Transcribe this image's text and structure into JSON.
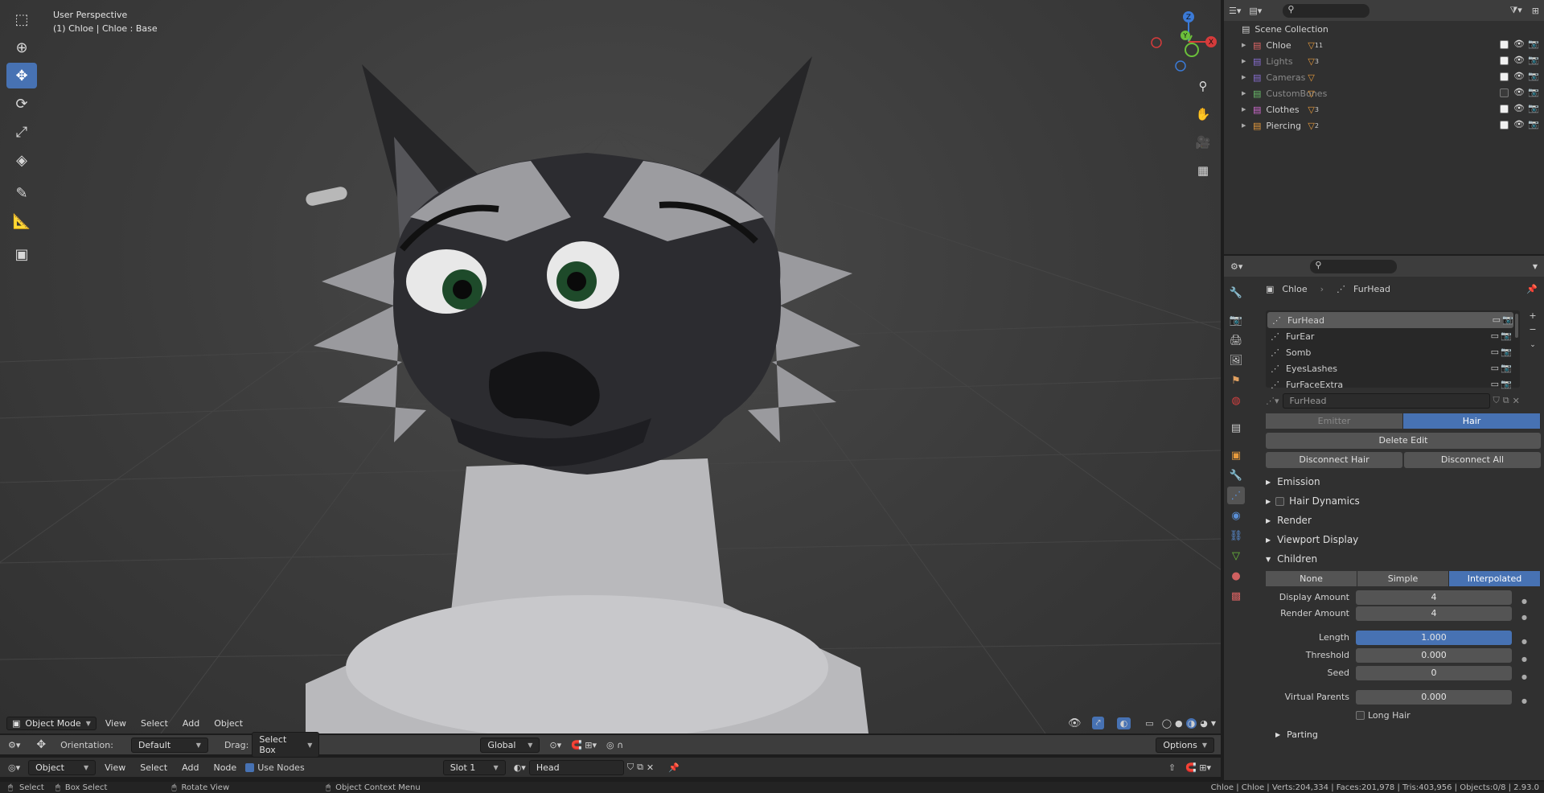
{
  "viewport": {
    "title": "User Perspective",
    "subtitle": "(1) Chloe | Chloe : Base",
    "tools": [
      "select-box-icon",
      "cursor-icon",
      "move-icon",
      "rotate-icon",
      "scale-icon",
      "transform-icon",
      "annotate-icon",
      "measure-icon",
      "add-cube-icon"
    ],
    "gizmo": {
      "z": "Z",
      "y": "Y",
      "x": "X"
    },
    "header": {
      "mode": "Object Mode",
      "menus": [
        "View",
        "Select",
        "Add",
        "Object"
      ]
    }
  },
  "tool_settings": {
    "orientation_label": "Orientation:",
    "orientation_value": "Default",
    "drag_label": "Drag:",
    "drag_value": "Select Box",
    "transform_space": "Global",
    "options": "Options"
  },
  "node_editor": {
    "mode": "Object",
    "menus": [
      "View",
      "Select",
      "Add",
      "Node"
    ],
    "use_nodes": "Use Nodes",
    "slot": "Slot 1",
    "material": "Head"
  },
  "outliner": {
    "root": "Scene Collection",
    "items": [
      {
        "name": "Chloe",
        "badge": "11",
        "color": "#e06666",
        "checked": true,
        "dim": false
      },
      {
        "name": "Lights",
        "badge": "3",
        "color": "#8a6fd6",
        "checked": true,
        "dim": true
      },
      {
        "name": "Cameras",
        "badge": "",
        "color": "#8a6fd6",
        "checked": true,
        "dim": true
      },
      {
        "name": "CustomBones",
        "badge": "",
        "color": "#6bbf6b",
        "checked": false,
        "dim": true
      },
      {
        "name": "Clothes",
        "badge": "3",
        "color": "#d46cd4",
        "checked": true,
        "dim": false
      },
      {
        "name": "Piercing",
        "badge": "2",
        "color": "#e69a3c",
        "checked": true,
        "dim": false
      }
    ]
  },
  "properties": {
    "breadcrumb_object": "Chloe",
    "breadcrumb_system": "FurHead",
    "particle_systems": [
      "FurHead",
      "FurEar",
      "Somb",
      "EyesLashes",
      "FurFaceExtra"
    ],
    "selected_system": "FurHead",
    "settings_name": "FurHead",
    "type_options": [
      "Emitter",
      "Hair"
    ],
    "type_selected": "Hair",
    "delete_edit": "Delete Edit",
    "disconnect_hair": "Disconnect Hair",
    "disconnect_all": "Disconnect All",
    "sections": {
      "emission": "Emission",
      "hair_dynamics": "Hair Dynamics",
      "render": "Render",
      "viewport_display": "Viewport Display",
      "children": "Children",
      "parting": "Parting"
    },
    "children_modes": [
      "None",
      "Simple",
      "Interpolated"
    ],
    "children_selected": "Interpolated",
    "fields": {
      "display_amount_label": "Display Amount",
      "display_amount": "4",
      "render_amount_label": "Render Amount",
      "render_amount": "4",
      "length_label": "Length",
      "length": "1.000",
      "threshold_label": "Threshold",
      "threshold": "0.000",
      "seed_label": "Seed",
      "seed": "0",
      "virtual_parents_label": "Virtual Parents",
      "virtual_parents": "0.000",
      "long_hair": "Long Hair"
    }
  },
  "statusbar": {
    "select": "Select",
    "box_select": "Box Select",
    "rotate_view": "Rotate View",
    "context_menu": "Object Context Menu",
    "stats": "Chloe | Chloe | Verts:204,334 | Faces:201,978 | Tris:403,956 | Objects:0/8 | 2.93.0"
  },
  "colors": {
    "accent": "#4772b3",
    "bg": "#303030",
    "header": "#3d3d3d"
  }
}
